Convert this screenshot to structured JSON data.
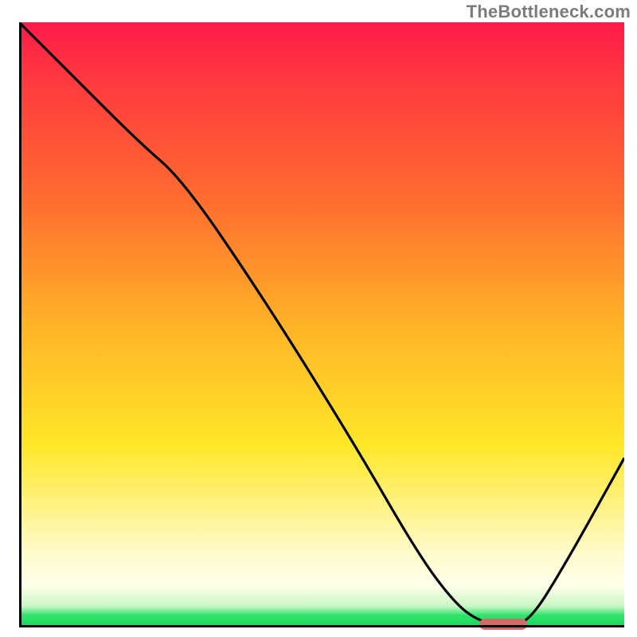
{
  "watermark": "TheBottleneck.com",
  "chart_data": {
    "type": "line",
    "title": "",
    "xlabel": "",
    "ylabel": "",
    "xlim": [
      0,
      100
    ],
    "ylim": [
      0,
      100
    ],
    "grid": false,
    "legend": false,
    "gradient_stops": [
      {
        "pos": 0,
        "color": "#ff1b4a"
      },
      {
        "pos": 10,
        "color": "#ff3a3f"
      },
      {
        "pos": 30,
        "color": "#ff6e2f"
      },
      {
        "pos": 50,
        "color": "#ffb327"
      },
      {
        "pos": 70,
        "color": "#ffe728"
      },
      {
        "pos": 88,
        "color": "#fffccf"
      },
      {
        "pos": 93,
        "color": "#ffffe9"
      },
      {
        "pos": 96.5,
        "color": "#c9f7c4"
      },
      {
        "pos": 98,
        "color": "#2fe36a"
      },
      {
        "pos": 100,
        "color": "#19d65d"
      }
    ],
    "series": [
      {
        "name": "bottleneck-curve",
        "x": [
          0,
          8,
          20,
          27,
          40,
          55,
          66,
          72,
          76,
          80,
          84,
          90,
          100
        ],
        "y": [
          100,
          92,
          80,
          74,
          55,
          31,
          12,
          4,
          1,
          0.5,
          0.5,
          10,
          28
        ]
      }
    ],
    "marker": {
      "name": "optimal-range",
      "x_start": 76,
      "x_end": 84,
      "y": 0.5,
      "color": "#d46a6a"
    }
  }
}
